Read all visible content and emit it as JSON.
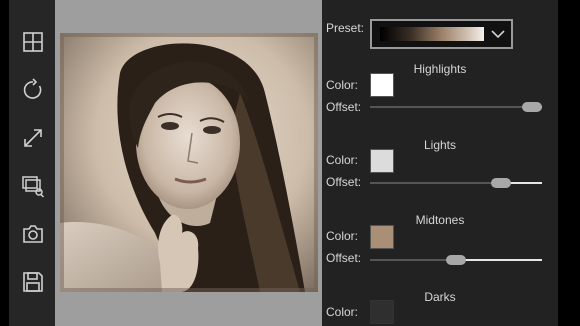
{
  "toolbar": {
    "tools": [
      {
        "icon": "grid-icon"
      },
      {
        "icon": "rotate-icon"
      },
      {
        "icon": "resize-arrows-icon"
      },
      {
        "icon": "gallery-search-icon"
      },
      {
        "icon": "camera-icon"
      },
      {
        "icon": "save-icon"
      }
    ]
  },
  "panel": {
    "preset_label": "Preset:",
    "sections": [
      {
        "title": "Highlights",
        "color_label": "Color:",
        "color": "#ffffff",
        "offset_label": "Offset:",
        "offset": 0.94
      },
      {
        "title": "Lights",
        "color_label": "Color:",
        "color": "#dcdcdc",
        "offset_label": "Offset:",
        "offset": 0.76
      },
      {
        "title": "Midtones",
        "color_label": "Color:",
        "color": "#a88f76",
        "offset_label": "Offset:",
        "offset": 0.5
      },
      {
        "title": "Darks",
        "color_label": "Color:",
        "color": "#2f2f2f"
      }
    ]
  },
  "colors": {
    "panel_bg": "#222222",
    "toolbar_bg": "#262626",
    "canvas_bg": "#9e9e9e"
  }
}
